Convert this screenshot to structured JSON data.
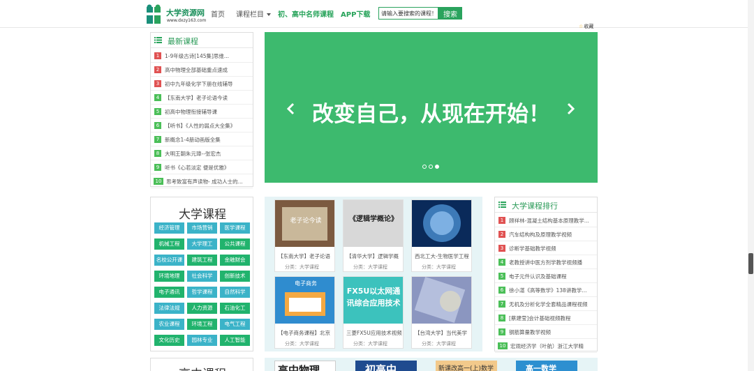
{
  "header": {
    "logo_text": "大学资源网",
    "logo_url": "www.dxzy163.com",
    "nav": {
      "home": "首页",
      "courses": "课程栏目",
      "teachers": "初、高中名师课程",
      "app": "APP下载"
    },
    "search": {
      "placeholder": "请输入要搜索的课程！",
      "button": "搜索"
    },
    "bookmark": "收藏"
  },
  "latest": {
    "title": "最新课程",
    "items": [
      {
        "num": "1",
        "text": "1-9年级古诗[145集]思维..."
      },
      {
        "num": "2",
        "text": "高中物理全部基础重点速成"
      },
      {
        "num": "3",
        "text": "初中九年级化学下册在线辅导"
      },
      {
        "num": "4",
        "text": "【东南大学】老子论语今读"
      },
      {
        "num": "5",
        "text": "初高中物理衔接辅导课"
      },
      {
        "num": "6",
        "text": "【听书】《人性的弱点大全集》"
      },
      {
        "num": "7",
        "text": "新概念1-4册动画版全集"
      },
      {
        "num": "8",
        "text": "大明王朝朱元璋--张宏杰"
      },
      {
        "num": "9",
        "text": "听书《心若淡定 便是优雅》"
      },
      {
        "num": "10",
        "text": "思考致富有声读物- 成功人士的..."
      }
    ]
  },
  "banner": {
    "text": "改变自己，从现在开始！"
  },
  "categories": {
    "title": "大学课程",
    "tags": [
      "经济管理",
      "市场营销",
      "医学课程",
      "机械工程",
      "大学理工",
      "公共课程",
      "名校公开课",
      "建筑工程",
      "金融财会",
      "环境地理",
      "社会科学",
      "创新技术",
      "电子通讯",
      "哲学课程",
      "自然科学",
      "法律法规",
      "人力资源",
      "石油化工",
      "农业课程",
      "环境工程",
      "电气工程",
      "文化历史",
      "园林专业",
      "人工智能"
    ],
    "title2": "高中课程"
  },
  "courses": [
    {
      "title": "【东南大学】老子论语",
      "category": "分类：大学课程",
      "thumb_text": "老子论今读"
    },
    {
      "title": "【清华大学】逻辑学概",
      "category": "分类：大学课程",
      "thumb_text": "《逻辑学概论》"
    },
    {
      "title": "西北工大-生物医学工程",
      "category": "分类：大学课程",
      "thumb_text": ""
    },
    {
      "title": "【电子商务课程】北京",
      "category": "分类：大学课程",
      "thumb_text": "电子商务"
    },
    {
      "title": "三菱FX5U应用技术视频",
      "category": "分类：大学课程",
      "thumb_text": "FX5U以太网通讯综合应用技术"
    },
    {
      "title": "【台湾大学】当代美学",
      "category": "分类：大学课程",
      "thumb_text": ""
    }
  ],
  "ranking": {
    "title": "大学课程排行",
    "items": [
      {
        "num": "1",
        "text": "顾祥林-混凝土结构基本原理教学..."
      },
      {
        "num": "2",
        "text": "汽车结构构及原理教学视频"
      },
      {
        "num": "3",
        "text": "诊断学基础教学视频"
      },
      {
        "num": "4",
        "text": "老教授讲中医方剂学教学视频播"
      },
      {
        "num": "5",
        "text": "电子元件认识及基础课程"
      },
      {
        "num": "6",
        "text": "徐小湛《高等数学》138讲教学..."
      },
      {
        "num": "7",
        "text": "无机及分析化学全套精品课程视频"
      },
      {
        "num": "8",
        "text": "[蔡建莹]会计基础视频教程"
      },
      {
        "num": "9",
        "text": "钢筋算量教学视频"
      },
      {
        "num": "10",
        "text": "宏观经济学（叶航）浙江大学精"
      }
    ]
  },
  "bottom_cards": [
    {
      "text": "高中物理"
    },
    {
      "text": "初高中"
    },
    {
      "text": "新课改高一(上)数学"
    },
    {
      "text": "高一数学"
    }
  ],
  "colors": {
    "accent": "#27a35a",
    "banner": "#3dba6e",
    "rank_top": "#e05252",
    "rank_other": "#4bbf58",
    "tag_blue": "#3bb3c8",
    "tag_green": "#21b36d"
  }
}
